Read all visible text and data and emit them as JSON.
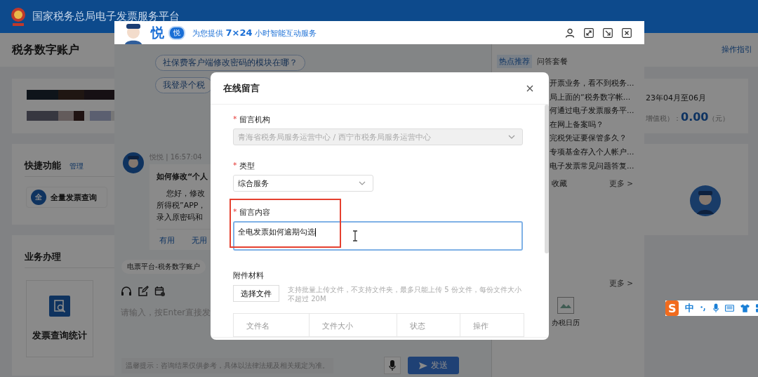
{
  "header": {
    "title": "国家税务总局电子发票服务平台"
  },
  "page": {
    "title": "税务数字账户",
    "guide_link": "操作指引"
  },
  "shortcuts": {
    "title": "快捷功能",
    "manage": "管理",
    "items": [
      {
        "badge": "全",
        "label": "全量发票查询"
      }
    ]
  },
  "business": {
    "title": "业务办理",
    "tiles": [
      {
        "label": "发票查询统计"
      }
    ]
  },
  "summary": {
    "period": "23年04月至06月",
    "tax_label": "增值税）：",
    "amount": "0.00",
    "unit": "（元）"
  },
  "chat": {
    "brand": "悦",
    "brand_badge": "悦",
    "tagline": "为您提供 **7×24** 小时智能互动服务",
    "suggestions": [
      "社保费客户端修改密码的模块在哪？",
      "我登录个税"
    ],
    "message": {
      "sender": "悦悦 | 16:57:04",
      "title": "如何修改“个人",
      "lines": [
        "您好，修改",
        "所得税”APP，",
        "录入原密码和"
      ],
      "actions": [
        "有用",
        "无用"
      ]
    },
    "context_tag": "电票平台-税务数字账户",
    "input": {
      "placeholder": "请输入，按Enter直接发"
    },
    "tip": "温馨提示：咨询结果仅供参考，具体以法律法规及相关规定为准。",
    "send": "发送",
    "tabs": [
      {
        "label": "热点推荐",
        "selected": true
      },
      {
        "label": "问答套餐",
        "selected": false
      }
    ],
    "hot_questions": [
      "开票业务，看不到税务...",
      "局上面的“税务数字帐...",
      "何通过电子发票服务平...",
      "在网上备案吗？",
      "完税凭证要保管多久？",
      "专项基金存入个人帐户...",
      "电子发票常见问题答复..."
    ],
    "favorites": {
      "title": "收藏",
      "more": "更多 >"
    },
    "tools": {
      "more": "更多 >",
      "items": [
        {
          "label": "办税日历"
        }
      ]
    }
  },
  "dialog": {
    "title": "在线留言",
    "fields": [
      {
        "kind": "select",
        "mark": "*",
        "label": "留言机构",
        "value": "青海省税务局服务运营中心 / 西宁市税务局服务运营中心",
        "disabled": true
      },
      {
        "kind": "select",
        "mark": "*",
        "label": "类型",
        "value": "综合服务",
        "disabled": false
      },
      {
        "kind": "textarea",
        "mark": "*",
        "label": "留言内容",
        "value": "全电发票如何逾期勾选",
        "highlighted": true
      }
    ],
    "attachments": {
      "label": "附件材料",
      "button": "选择文件",
      "hint": "支持批量上传文件，不支持文件夹，最多只能上传 5 份文件，每份文件大小不超过 20M",
      "columns": [
        "文件名",
        "文件大小",
        "状态",
        "操作"
      ]
    }
  },
  "ime": {
    "logo": "S",
    "mode": "中"
  }
}
